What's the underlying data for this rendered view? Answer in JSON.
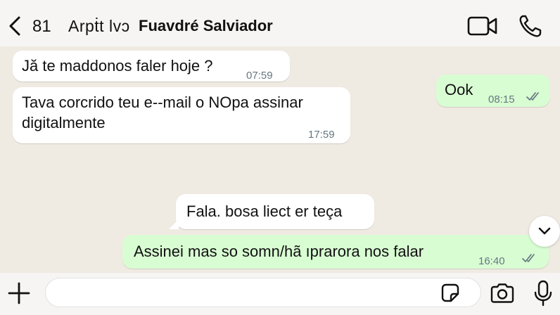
{
  "header": {
    "back_count": "81",
    "contact_prefix": "Arpṫt lvɔ",
    "contact_name": "Fuavdré Salviador",
    "icons": [
      "chevron-left-icon",
      "video-call-icon",
      "phone-icon"
    ]
  },
  "messages": [
    {
      "direction": "incoming",
      "text": "Jă te maddonos faler hoje ?",
      "time": "07:59"
    },
    {
      "direction": "incoming",
      "text_line1": "Tava corcrido teu e--mail o NOpa assinar",
      "text_line2": "digitalmente",
      "time": "17:59"
    },
    {
      "direction": "outgoing",
      "text": "Ook",
      "time": "08:15",
      "status": "read"
    },
    {
      "direction": "incoming",
      "text": "Fala. bosa liect er teça"
    },
    {
      "direction": "outgoing",
      "text": "Assinei mas so somn/hã ıprarora nos falar",
      "time": "16:40",
      "status": "read"
    }
  ],
  "composer": {
    "value": "",
    "placeholder": "",
    "icons": [
      "plus-icon",
      "sticker-icon",
      "camera-icon",
      "microphone-icon"
    ]
  },
  "colors": {
    "incoming_bubble": "#ffffff",
    "outgoing_bubble": "#d9fdd3",
    "background": "#efeae2",
    "timestamp": "#667781"
  }
}
